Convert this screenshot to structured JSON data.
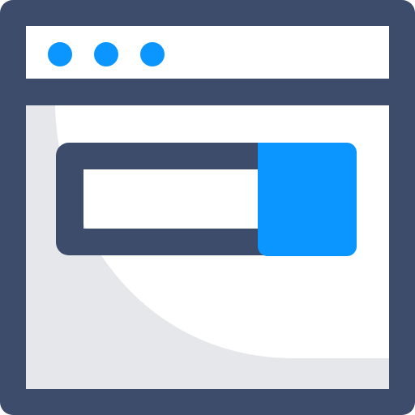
{
  "icon": {
    "name": "browser-window-search-icon",
    "colors": {
      "frame": "#3D4C6B",
      "accent": "#0A95FF",
      "panel_shadow": "#E6E7EA",
      "background": "#FFFFFF"
    }
  }
}
